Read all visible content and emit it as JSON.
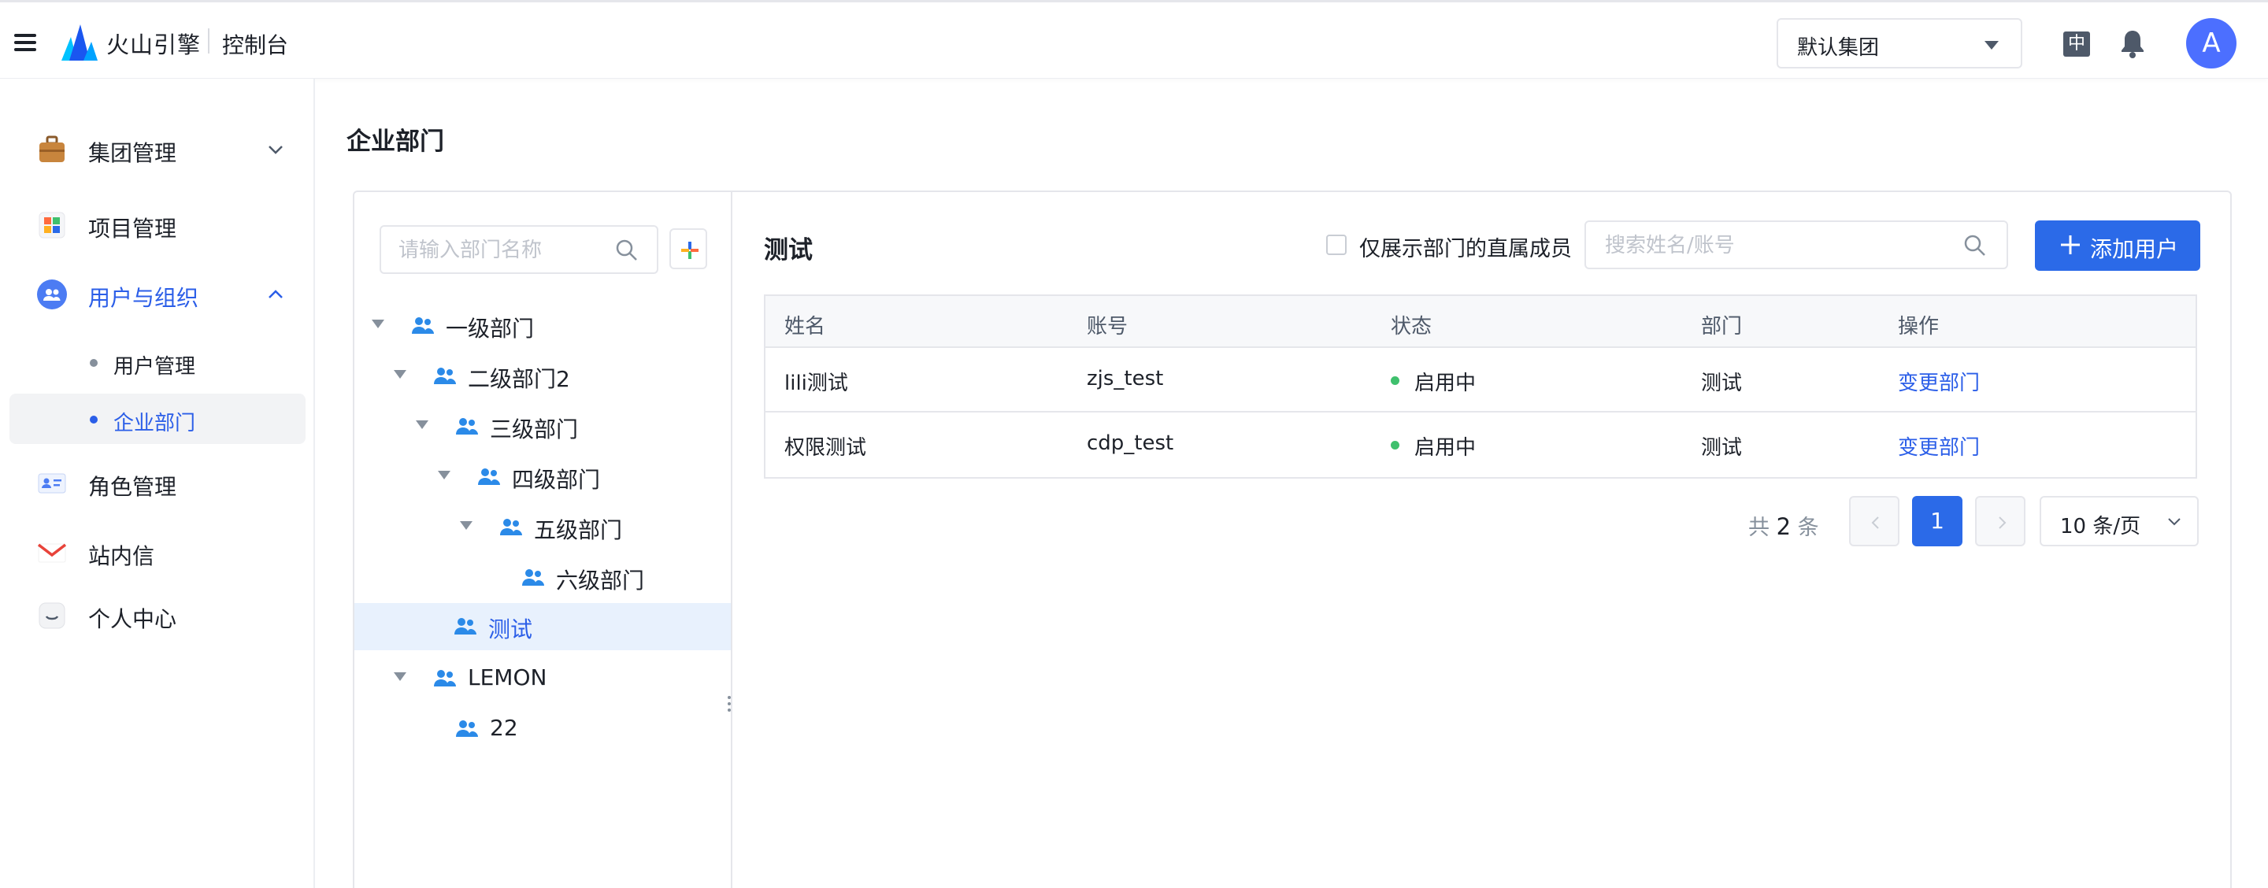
{
  "header": {
    "brand": "火山引擎",
    "console": "控制台",
    "group_select": "默认集团",
    "lang": "中",
    "avatar": "A"
  },
  "sidebar": {
    "items": [
      {
        "label": "集团管理",
        "icon": "briefcase-icon",
        "expanded": false
      },
      {
        "label": "项目管理",
        "icon": "grid-icon"
      },
      {
        "label": "用户与组织",
        "icon": "users-icon",
        "expanded": true,
        "active": true
      },
      {
        "label": "角色管理",
        "icon": "id-card-icon"
      },
      {
        "label": "站内信",
        "icon": "mail-icon"
      },
      {
        "label": "个人中心",
        "icon": "smile-icon"
      }
    ],
    "sub_items": [
      {
        "label": "用户管理",
        "active": false
      },
      {
        "label": "企业部门",
        "active": true
      }
    ]
  },
  "page": {
    "title": "企业部门"
  },
  "tree": {
    "search_placeholder": "请输入部门名称",
    "nodes": [
      {
        "label": "一级部门",
        "level": 0,
        "expandable": true
      },
      {
        "label": "二级部门2",
        "level": 1,
        "expandable": true
      },
      {
        "label": "三级部门",
        "level": 2,
        "expandable": true
      },
      {
        "label": "四级部门",
        "level": 3,
        "expandable": true
      },
      {
        "label": "五级部门",
        "level": 4,
        "expandable": true
      },
      {
        "label": "六级部门",
        "level": 5,
        "expandable": false
      },
      {
        "label": "测试",
        "level": 2,
        "expandable": false,
        "selected": true
      },
      {
        "label": "LEMON",
        "level": 1,
        "expandable": true
      },
      {
        "label": "22",
        "level": 2,
        "expandable": false
      }
    ]
  },
  "detail": {
    "title": "测试",
    "direct_only_label": "仅展示部门的直属成员",
    "user_search_placeholder": "搜索姓名/账号",
    "add_user_label": "添加用户",
    "columns": [
      "姓名",
      "账号",
      "状态",
      "部门",
      "操作"
    ],
    "rows": [
      {
        "name": "lili测试",
        "account": "zjs_test",
        "status": "启用中",
        "dept": "测试",
        "action": "变更部门"
      },
      {
        "name": "权限测试",
        "account": "cdp_test",
        "status": "启用中",
        "dept": "测试",
        "action": "变更部门"
      }
    ],
    "pagination": {
      "total_prefix": "共",
      "total": "2",
      "total_suffix": "条",
      "current_page": "1",
      "page_size": "10 条/页"
    }
  },
  "colors": {
    "primary": "#2b6ae8",
    "active_text": "#2b5ee8",
    "status_green": "#3fc06d",
    "selected_bg": "#e8f1fd"
  }
}
